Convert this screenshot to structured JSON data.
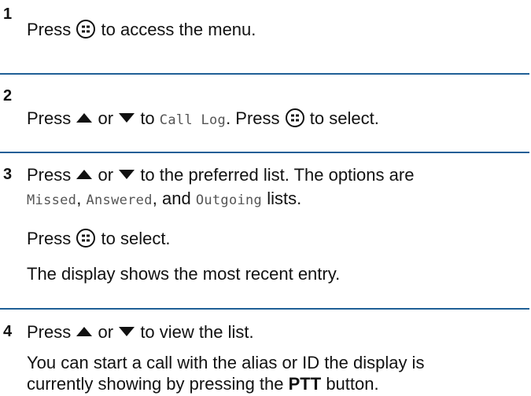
{
  "steps": [
    {
      "number": "1",
      "lines": [
        {
          "press": "Press",
          "text": "to access the menu."
        }
      ]
    },
    {
      "number": "2",
      "line": {
        "press": "Press",
        "or": "or",
        "to": "to",
        "target": "Call Log",
        "dot_press": ". Press",
        "end": "to select."
      }
    },
    {
      "number": "3",
      "line1": {
        "press": "Press",
        "or": "or",
        "text": "to the preferred list. The options are"
      },
      "line2": {
        "opt1": "Missed",
        "sep1": ",",
        "opt2": "Answered",
        "sep2": ", and",
        "opt3": "Outgoing",
        "end": "lists."
      },
      "line3": {
        "press": "Press",
        "text": "to select."
      },
      "line4": {
        "text": "The display shows the most recent entry."
      }
    },
    {
      "number": "4",
      "line1": {
        "press": "Press",
        "or": "or",
        "text": "to view the list."
      },
      "line2": {
        "text": "You can start a call with the alias or ID the display is"
      },
      "line3": {
        "pre": "currently showing by pressing the",
        "bold": "PTT",
        "post": "button."
      }
    }
  ],
  "icons": {
    "menu_ok_button": "menu-ok-button-icon",
    "up_arrow": "up-arrow-icon",
    "down_arrow": "down-arrow-icon"
  },
  "colors": {
    "separator": "#1f5f96",
    "text": "#111111",
    "mono_text": "#555555"
  }
}
